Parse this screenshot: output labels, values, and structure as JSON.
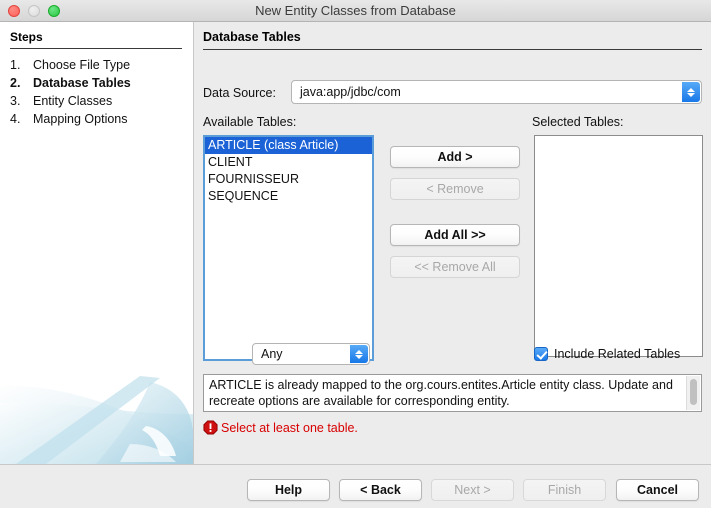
{
  "window": {
    "title": "New Entity Classes from Database",
    "traffic_lights": [
      "close-red",
      "minimize-disabled",
      "zoom-green"
    ]
  },
  "steps_panel": {
    "heading": "Steps",
    "items": [
      {
        "num": "1.",
        "label": "Choose File Type",
        "current": false
      },
      {
        "num": "2.",
        "label": "Database Tables",
        "current": true
      },
      {
        "num": "3.",
        "label": "Entity Classes",
        "current": false
      },
      {
        "num": "4.",
        "label": "Mapping Options",
        "current": false
      }
    ]
  },
  "content": {
    "section_title": "Database Tables",
    "data_source": {
      "label": "Data Source:",
      "value": "java:app/jdbc/com"
    },
    "available": {
      "label": "Available Tables:",
      "items": [
        {
          "text": "ARTICLE (class Article)",
          "selected": true
        },
        {
          "text": "CLIENT",
          "selected": false
        },
        {
          "text": "FOURNISSEUR",
          "selected": false
        },
        {
          "text": "SEQUENCE",
          "selected": false
        }
      ]
    },
    "selected": {
      "label": "Selected Tables:",
      "items": []
    },
    "transfer_buttons": {
      "add": "Add >",
      "remove": "< Remove",
      "add_all": "Add All >>",
      "remove_all": "<< Remove All"
    },
    "filter": {
      "value": "Any"
    },
    "include_related": {
      "label": "Include Related Tables",
      "checked": true
    },
    "info_text": "ARTICLE is already mapped to the org.cours.entites.Article entity class. Update and recreate options are available for corresponding entity.",
    "error": {
      "icon": "error-octagon-icon",
      "text": "Select at least one table."
    }
  },
  "footer": {
    "help": "Help",
    "back": "< Back",
    "next": "Next >",
    "finish": "Finish",
    "cancel": "Cancel"
  },
  "colors": {
    "selection_blue": "#1a62d6",
    "accent_blue": "#1878e8",
    "error_red": "#d80000",
    "window_bg": "#ececec",
    "panel_white": "#ffffff"
  }
}
